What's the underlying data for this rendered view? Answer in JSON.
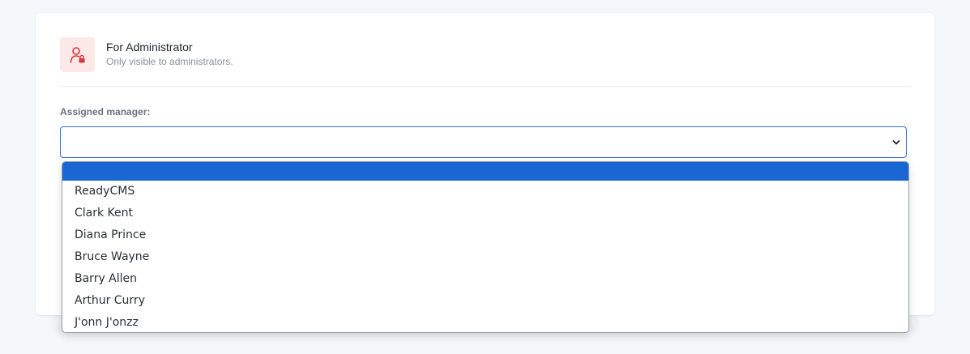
{
  "section": {
    "title": "For Administrator",
    "subtitle": "Only visible to administrators.",
    "icon": "user-lock-icon",
    "icon_bg": "#fde8e8",
    "icon_color": "#d9363e"
  },
  "field": {
    "label": "Assigned manager:",
    "value": ""
  },
  "dropdown": {
    "options": [
      "",
      "ReadyCMS",
      "Clark Kent",
      "Diana Prince",
      "Bruce Wayne",
      "Barry Allen",
      "Arthur Curry",
      "J'onn J'onzz"
    ],
    "selected_index": 0,
    "highlight_color": "#1a66d2",
    "focus_border": "#2f6fd6"
  }
}
